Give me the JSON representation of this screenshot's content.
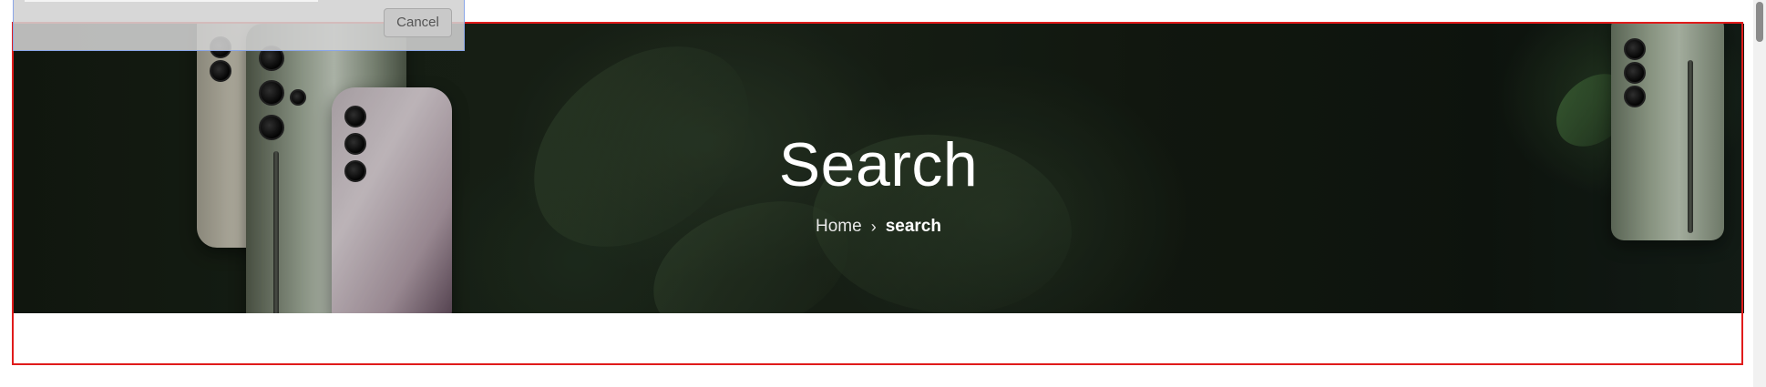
{
  "hero": {
    "title": "Search",
    "breadcrumb": {
      "home_label": "Home",
      "separator": "›",
      "current_label": "search"
    }
  },
  "search_dialog": {
    "cancel_label": "Cancel"
  },
  "colors": {
    "section_outline": "#e01b1b",
    "dialog_border": "#8aa6e8",
    "hero_text": "#ffffff"
  },
  "icons": {
    "breadcrumb_separator": "chevron-right-icon"
  }
}
